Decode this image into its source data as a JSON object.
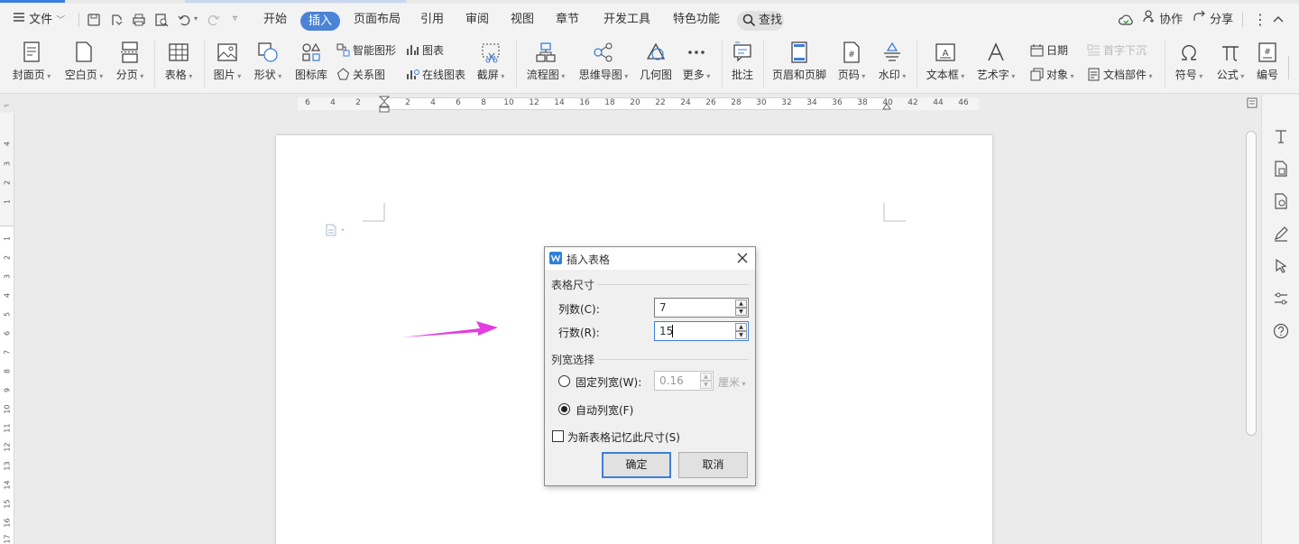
{
  "menubar": {
    "file_label": "文件",
    "tabs": [
      {
        "label": "开始",
        "active": false
      },
      {
        "label": "插入",
        "active": true
      },
      {
        "label": "页面布局",
        "active": false
      },
      {
        "label": "引用",
        "active": false
      },
      {
        "label": "审阅",
        "active": false
      },
      {
        "label": "视图",
        "active": false
      },
      {
        "label": "章节",
        "active": false
      },
      {
        "label": "开发工具",
        "active": false
      },
      {
        "label": "特色功能",
        "active": false
      }
    ],
    "search_label": "查找",
    "collab_label": "协作",
    "share_label": "分享"
  },
  "ribbon": {
    "cover_page": "封面页",
    "blank_page": "空白页",
    "page_break": "分页",
    "table": "表格",
    "picture": "图片",
    "shape": "形状",
    "icon_lib": "图标库",
    "smart_art": "智能图形",
    "relation": "关系图",
    "chart": "图表",
    "online_chart": "在线图表",
    "screenshot": "截屏",
    "flowchart": "流程图",
    "mindmap": "思维导图",
    "geometry": "几何图",
    "more": "更多",
    "comment": "批注",
    "header_footer": "页眉和页脚",
    "page_number": "页码",
    "watermark": "水印",
    "textbox": "文本框",
    "wordart": "艺术字",
    "date": "日期",
    "object": "对象",
    "drop_cap": "首字下沉",
    "doc_parts": "文档部件",
    "symbol": "符号",
    "formula": "公式",
    "numbering": "编号"
  },
  "ruler": {
    "h_left_ticks": [
      "6",
      "4",
      "2"
    ],
    "h_ticks": [
      "2",
      "4",
      "6",
      "8",
      "10",
      "12",
      "14",
      "16",
      "18",
      "20",
      "22",
      "24",
      "26",
      "28",
      "30",
      "32",
      "34",
      "36",
      "38"
    ],
    "h_right_ticks": [
      "40",
      "42",
      "44",
      "46"
    ],
    "v_top_ticks": [
      "4",
      "3",
      "2",
      "1"
    ],
    "v_ticks": [
      "1",
      "2",
      "3",
      "4",
      "5",
      "6",
      "7",
      "8",
      "9",
      "10",
      "11",
      "12",
      "13",
      "14",
      "15",
      "16",
      "17"
    ]
  },
  "dialog": {
    "title": "插入表格",
    "size_group": "表格尺寸",
    "cols_label": "列数(C):",
    "cols_value": "7",
    "rows_label": "行数(R):",
    "rows_value": "15",
    "width_group": "列宽选择",
    "fixed_width_label": "固定列宽(W):",
    "fixed_width_value": "0.16",
    "unit_label": "厘米",
    "auto_width_label": "自动列宽(F)",
    "remember_label": "为新表格记忆此尺寸(S)",
    "ok_label": "确定",
    "cancel_label": "取消"
  },
  "colors": {
    "accent": "#4a83d8",
    "annotation_arrow": "#e33ce0"
  }
}
